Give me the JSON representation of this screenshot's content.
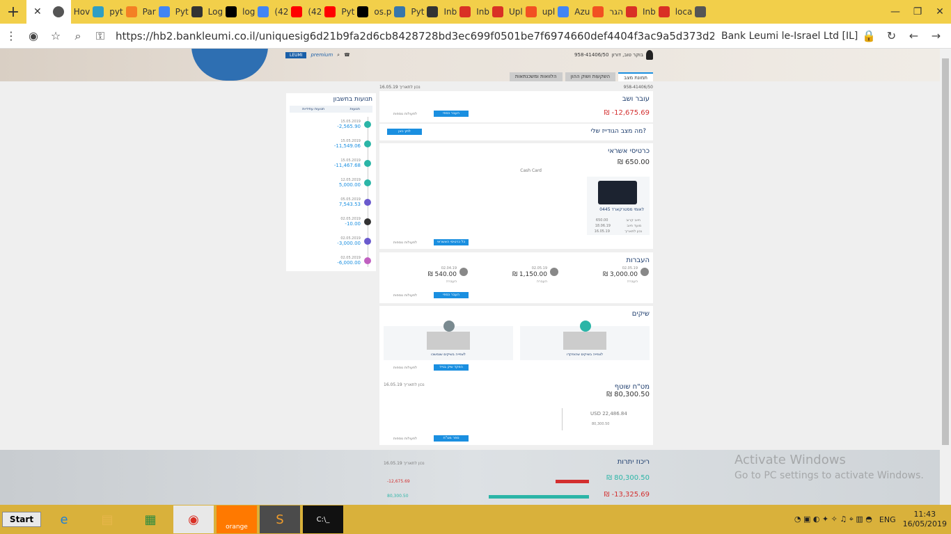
{
  "browser": {
    "tabs": [
      {
        "label": "Hov",
        "color": "#2f9ec4"
      },
      {
        "label": "pyt",
        "color": "#f48024"
      },
      {
        "label": "Par",
        "color": "#4285f4"
      },
      {
        "label": "Pyt",
        "color": "#333333"
      },
      {
        "label": "Log",
        "color": "#000000"
      },
      {
        "label": "log",
        "color": "#4285f4"
      },
      {
        "label": "(42",
        "color": "#ff0000"
      },
      {
        "label": "(42",
        "color": "#ff0000"
      },
      {
        "label": "Pyt",
        "color": "#000000"
      },
      {
        "label": "os.p",
        "color": "#3776ab"
      },
      {
        "label": "Pyt",
        "color": "#333333"
      },
      {
        "label": "Inb",
        "color": "#d93025"
      },
      {
        "label": "Inb",
        "color": "#d93025"
      },
      {
        "label": "Upl",
        "color": "#f25022"
      },
      {
        "label": "upl",
        "color": "#4285f4"
      },
      {
        "label": "Azu",
        "color": "#f25022"
      },
      {
        "label": "הגר",
        "color": "#d93025"
      },
      {
        "label": "Inb",
        "color": "#d93025"
      },
      {
        "label": "loca",
        "color": "#555555"
      }
    ],
    "url": "https://hb2.bankleumi.co.il/uniquesig6d21b9fa2d6cb8428728bd3ec699f0501be7f6974660def4404f3ac9a5d373d2/uniquesig0/ebanking/...",
    "site_name": "Bank Leumi le-Israel Ltd [IL]"
  },
  "header": {
    "greeting": "בוקר טוב, דורון",
    "account_label": "958-41406/50",
    "nav_tabs": [
      "תמונת מצב",
      "השקעות ושוק ההון",
      "הלוואות ומשכנתאות"
    ],
    "account_number": "958-41406/50",
    "updated": "נכון לתאריך 16.05.19"
  },
  "current_account": {
    "title": "עובר ושב",
    "balance": "-12,675.69",
    "currency": "₪",
    "button": "העבר כספי",
    "more": "לפעולות נוספות"
  },
  "promo": {
    "title": "מה מצב הגודייז שלי?",
    "button": "לחץ כאן"
  },
  "credit_cards": {
    "title": "כרטיסי אשראי",
    "amount": "650.00",
    "currency": "₪",
    "card_name": "לאומי מסטרקארד 0445",
    "note": "Cash Card",
    "rows": [
      {
        "label": "חיוב קרוב",
        "value": "650.00"
      },
      {
        "label": "מועד חיוב",
        "value": "18.06.19"
      },
      {
        "label": "נכון לתאריך",
        "value": "16.05.19"
      }
    ],
    "button": "כל כרטיסי האשראי",
    "more": "לפעולות נוספות"
  },
  "transfers": {
    "title": "העברות",
    "items": [
      {
        "date": "02.05.19",
        "amount": "3,000.00",
        "label": "העברה"
      },
      {
        "date": "02.05.19",
        "amount": "1,150.00",
        "label": "העברה"
      },
      {
        "date": "02.04.19",
        "amount": "540.00",
        "label": "העברה"
      }
    ],
    "currency": "₪",
    "button": "העבר כספי",
    "more": "לפעולות נוספות"
  },
  "checks": {
    "title": "שיקים",
    "items": [
      "לצפייה בשיקים שהופקדו",
      "לצפייה בשיקים שנמשכו"
    ],
    "button": "הפקד שיק בנייד",
    "more": "לפעולות נוספות"
  },
  "fx": {
    "title": "מט\"ח שוטף",
    "amount": "80,300.50",
    "currency": "₪",
    "usd_amount": "22,486.84",
    "usd_label": "USD",
    "sub_amount": "80,300.50",
    "updated": "נכון לתאריך 16.05.19",
    "button": "ספר מט\"ח",
    "more": "לפעולות נוספות"
  },
  "balances": {
    "title": "ריכוז יתרות",
    "updated": "נכון לתאריך 16.05.19",
    "positive": "80,300.50",
    "negative": "-13,325.69",
    "positive_bar": "80,300.50",
    "negative_bar": "-12,675.69",
    "currency": "₪"
  },
  "sidebar": {
    "title": "תנועות בחשבון",
    "filters": [
      "תנועות עתידיות",
      "תנועות"
    ],
    "items": [
      {
        "date": "15.05.2019",
        "amount": "-2,565.90",
        "color": "#2bb5a7"
      },
      {
        "date": "15.05.2019",
        "amount": "-11,549.06",
        "color": "#2bb5a7"
      },
      {
        "date": "15.05.2019",
        "amount": "-11,467.68",
        "color": "#2bb5a7"
      },
      {
        "date": "12.05.2019",
        "amount": "5,000.00",
        "color": "#2bb5a7"
      },
      {
        "date": "05.05.2019",
        "amount": "7,543.53",
        "color": "#6a5acd"
      },
      {
        "date": "02.05.2019",
        "amount": "-10.00",
        "color": "#333333"
      },
      {
        "date": "02.05.2019",
        "amount": "-3,000.00",
        "color": "#6a5acd"
      },
      {
        "date": "02.05.2019",
        "amount": "-6,000.00",
        "color": "#c060c0"
      }
    ]
  },
  "windows_watermark": {
    "line1": "Activate Windows",
    "line2": "Go to PC settings to activate Windows."
  },
  "taskbar": {
    "start": "Start",
    "lang": "ENG",
    "time": "11:43",
    "date": "16/05/2019",
    "apps": [
      "ie-icon",
      "explorer-icon",
      "store-icon",
      "chrome-icon",
      "orange-icon",
      "sublime-icon",
      "cmd-icon"
    ],
    "orange_label": "orange"
  }
}
